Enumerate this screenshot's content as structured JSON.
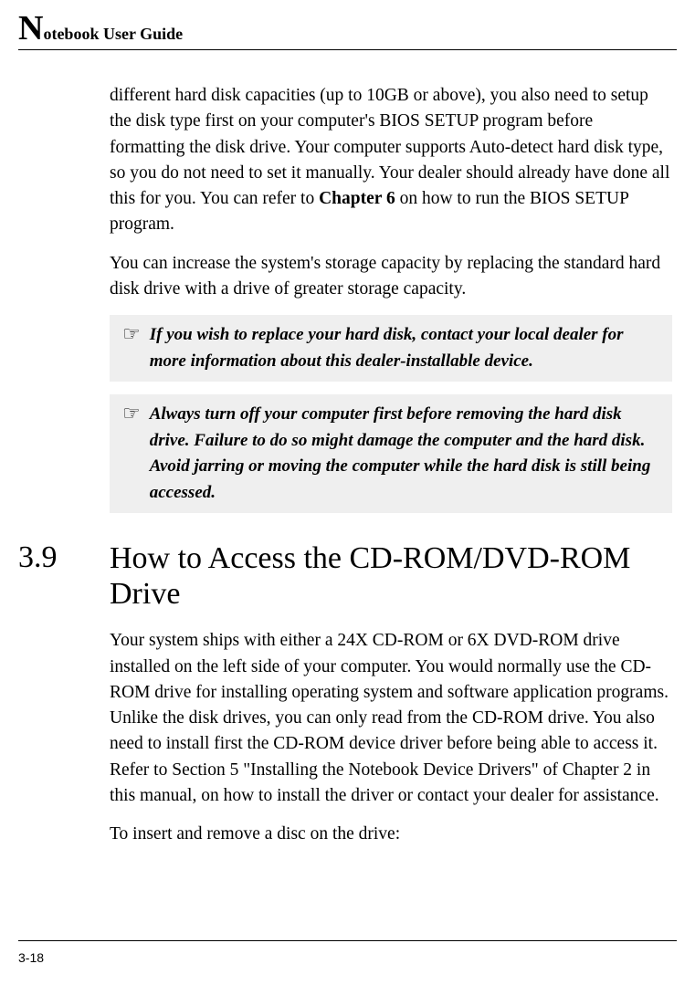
{
  "header": {
    "dropcap": "N",
    "rest": "otebook User Guide"
  },
  "paragraphs": {
    "p1a": "different hard disk capacities (up to 10GB or above), you also need to setup the disk type first on your computer's BIOS SETUP program before formatting the disk drive. Your computer supports Auto-detect hard disk type, so you do not need to set it manually. Your dealer should already have done all this for you. You can refer to ",
    "p1_chapref": "Chapter 6",
    "p1b": " on how to run the BIOS SETUP program.",
    "p2": "You can increase the system's storage capacity by replacing the standard hard disk drive with a drive of greater storage capacity."
  },
  "notes": {
    "icon": "☞",
    "n1": "If you wish to replace your hard disk, contact your local dealer for more information about this dealer-installable device.",
    "n2": "Always turn off your computer first before removing the hard disk drive. Failure to do so might damage the computer and the hard disk. Avoid jarring or moving the computer while the hard disk is still being accessed."
  },
  "section": {
    "num": "3.9",
    "title": "How to Access the CD-ROM/DVD-ROM Drive"
  },
  "paragraphs2": {
    "p3": "Your system ships with either a 24X CD-ROM or 6X DVD-ROM drive installed on the left side of your computer. You would normally use the CD-ROM drive for installing operating system and software application programs. Unlike the disk drives, you can only read from the CD-ROM drive. You also need to install first the CD-ROM device driver before being able to access it. Refer to Section 5 \"Installing the Notebook Device Drivers\" of Chapter 2 in this manual, on how to install the driver or contact your dealer for assistance.",
    "p4": "To insert and remove a disc on the drive:"
  },
  "pagenum": "3-18"
}
